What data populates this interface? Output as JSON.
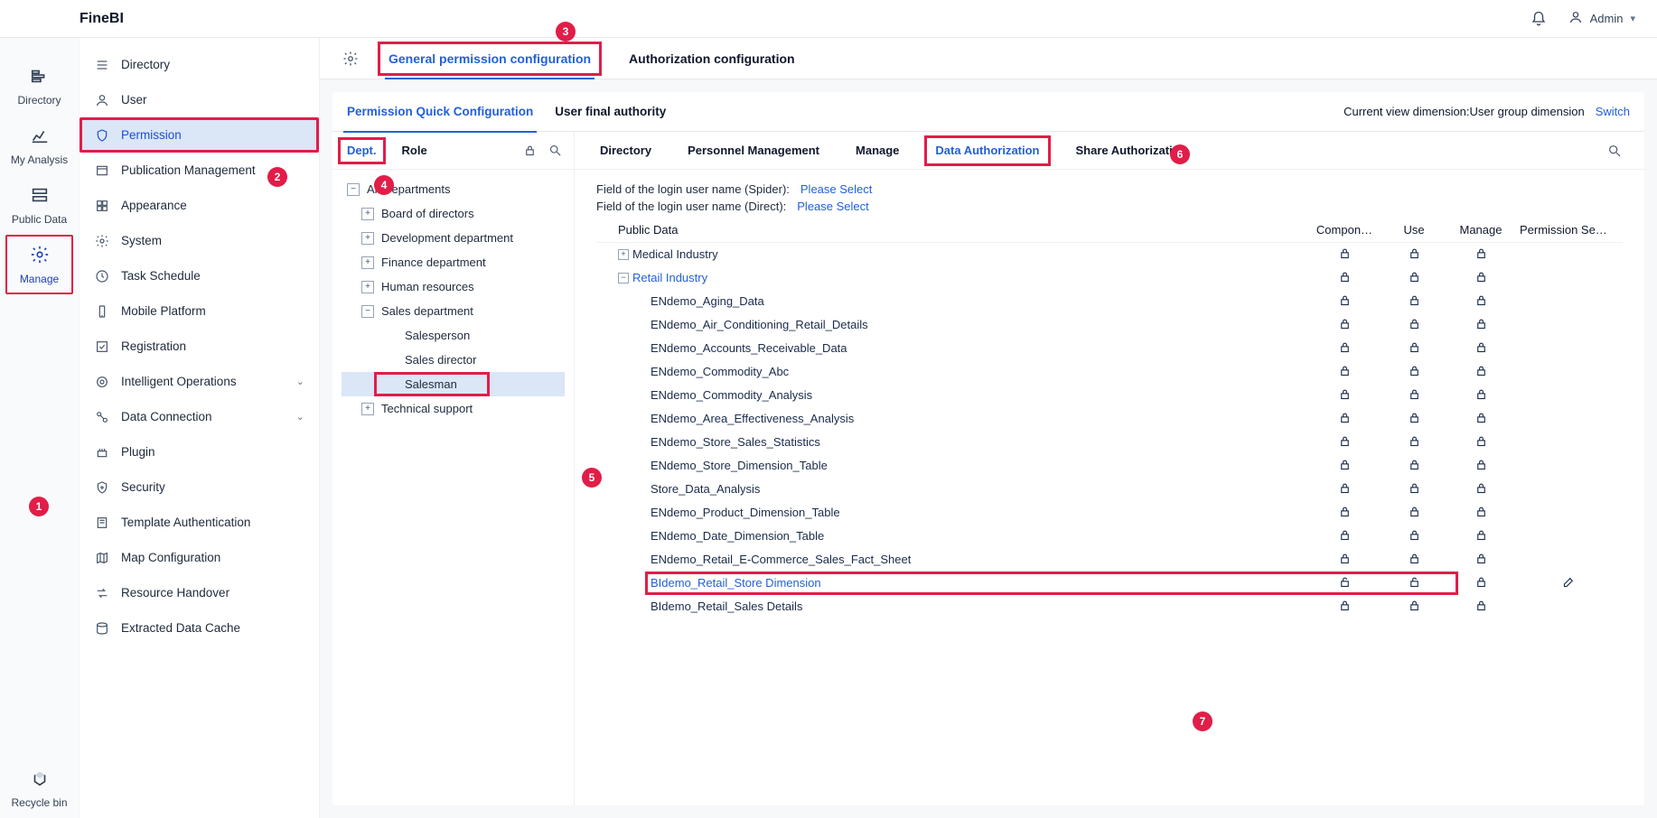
{
  "app_title": "FineBI",
  "topbar": {
    "user": "Admin"
  },
  "rail": [
    {
      "label": "Directory",
      "icon": "directory-icon"
    },
    {
      "label": "My Analysis",
      "icon": "analysis-icon"
    },
    {
      "label": "Public Data",
      "icon": "public-data-icon"
    },
    {
      "label": "Manage",
      "icon": "manage-icon"
    },
    {
      "label": "Recycle bin",
      "icon": "recycle-icon"
    }
  ],
  "sidebar": {
    "directory": "Directory",
    "user": "User",
    "permission": "Permission",
    "publication": "Publication Management",
    "appearance": "Appearance",
    "system": "System",
    "task_schedule": "Task Schedule",
    "mobile": "Mobile Platform",
    "registration": "Registration",
    "intelligent": "Intelligent Operations",
    "data_connection": "Data Connection",
    "plugin": "Plugin",
    "security": "Security",
    "template_auth": "Template Authentication",
    "map_config": "Map Configuration",
    "resource_handover": "Resource Handover",
    "extracted_cache": "Extracted Data Cache"
  },
  "main_tabs": {
    "general": "General permission configuration",
    "authorization": "Authorization configuration"
  },
  "sub_tabs": {
    "quick": "Permission Quick Configuration",
    "final": "User final authority",
    "view_label": "Current view dimension:User group dimension",
    "switch": "Switch"
  },
  "deptrole": {
    "dept": "Dept.",
    "role": "Role",
    "tree": {
      "root": "All Departments",
      "board": "Board of directors",
      "dev": "Development department",
      "finance": "Finance department",
      "hr": "Human resources",
      "sales": "Sales department",
      "salesperson": "Salesperson",
      "salesdirector": "Sales director",
      "salesman": "Salesman",
      "tech": "Technical support"
    }
  },
  "callouts": {
    "c1": "1",
    "c2": "2",
    "c3": "3",
    "c4": "4",
    "c5": "5",
    "c6": "6",
    "c7": "7"
  },
  "right_tabs": {
    "directory": "Directory",
    "personnel": "Personnel Management",
    "manage": "Manage",
    "data_auth": "Data Authorization",
    "share_auth": "Share Authorization"
  },
  "field_lines": {
    "spider_label": "Field of the login user name (Spider):",
    "direct_label": "Field of the login user name (Direct):",
    "select": "Please Select"
  },
  "table": {
    "cols": {
      "public": "Public Data",
      "compon": "Compon…",
      "use": "Use",
      "manage": "Manage",
      "permset": "Permission Se…"
    },
    "rows": [
      {
        "name": "Medical Industry",
        "indent": 1,
        "toggle": "+",
        "link": false,
        "unlock": false
      },
      {
        "name": "Retail Industry",
        "indent": 1,
        "toggle": "-",
        "link": true,
        "unlock": false
      },
      {
        "name": "ENdemo_Aging_Data",
        "indent": 2,
        "toggle": "",
        "link": false,
        "unlock": false
      },
      {
        "name": "ENdemo_Air_Conditioning_Retail_Details",
        "indent": 2,
        "toggle": "",
        "link": false,
        "unlock": false
      },
      {
        "name": "ENdemo_Accounts_Receivable_Data",
        "indent": 2,
        "toggle": "",
        "link": false,
        "unlock": false
      },
      {
        "name": "ENdemo_Commodity_Abc",
        "indent": 2,
        "toggle": "",
        "link": false,
        "unlock": false
      },
      {
        "name": "ENdemo_Commodity_Analysis",
        "indent": 2,
        "toggle": "",
        "link": false,
        "unlock": false
      },
      {
        "name": "ENdemo_Area_Effectiveness_Analysis",
        "indent": 2,
        "toggle": "",
        "link": false,
        "unlock": false
      },
      {
        "name": "ENdemo_Store_Sales_Statistics",
        "indent": 2,
        "toggle": "",
        "link": false,
        "unlock": false
      },
      {
        "name": "ENdemo_Store_Dimension_Table",
        "indent": 2,
        "toggle": "",
        "link": false,
        "unlock": false
      },
      {
        "name": "Store_Data_Analysis",
        "indent": 2,
        "toggle": "",
        "link": false,
        "unlock": false
      },
      {
        "name": "ENdemo_Product_Dimension_Table",
        "indent": 2,
        "toggle": "",
        "link": false,
        "unlock": false
      },
      {
        "name": "ENdemo_Date_Dimension_Table",
        "indent": 2,
        "toggle": "",
        "link": false,
        "unlock": false
      },
      {
        "name": "ENdemo_Retail_E-Commerce_Sales_Fact_Sheet",
        "indent": 2,
        "toggle": "",
        "link": false,
        "unlock": false
      },
      {
        "name": "BIdemo_Retail_Store Dimension",
        "indent": 2,
        "toggle": "",
        "link": true,
        "unlock": true,
        "red": true,
        "edit": true
      },
      {
        "name": "BIdemo_Retail_Sales Details",
        "indent": 2,
        "toggle": "",
        "link": false,
        "unlock": false
      }
    ]
  }
}
